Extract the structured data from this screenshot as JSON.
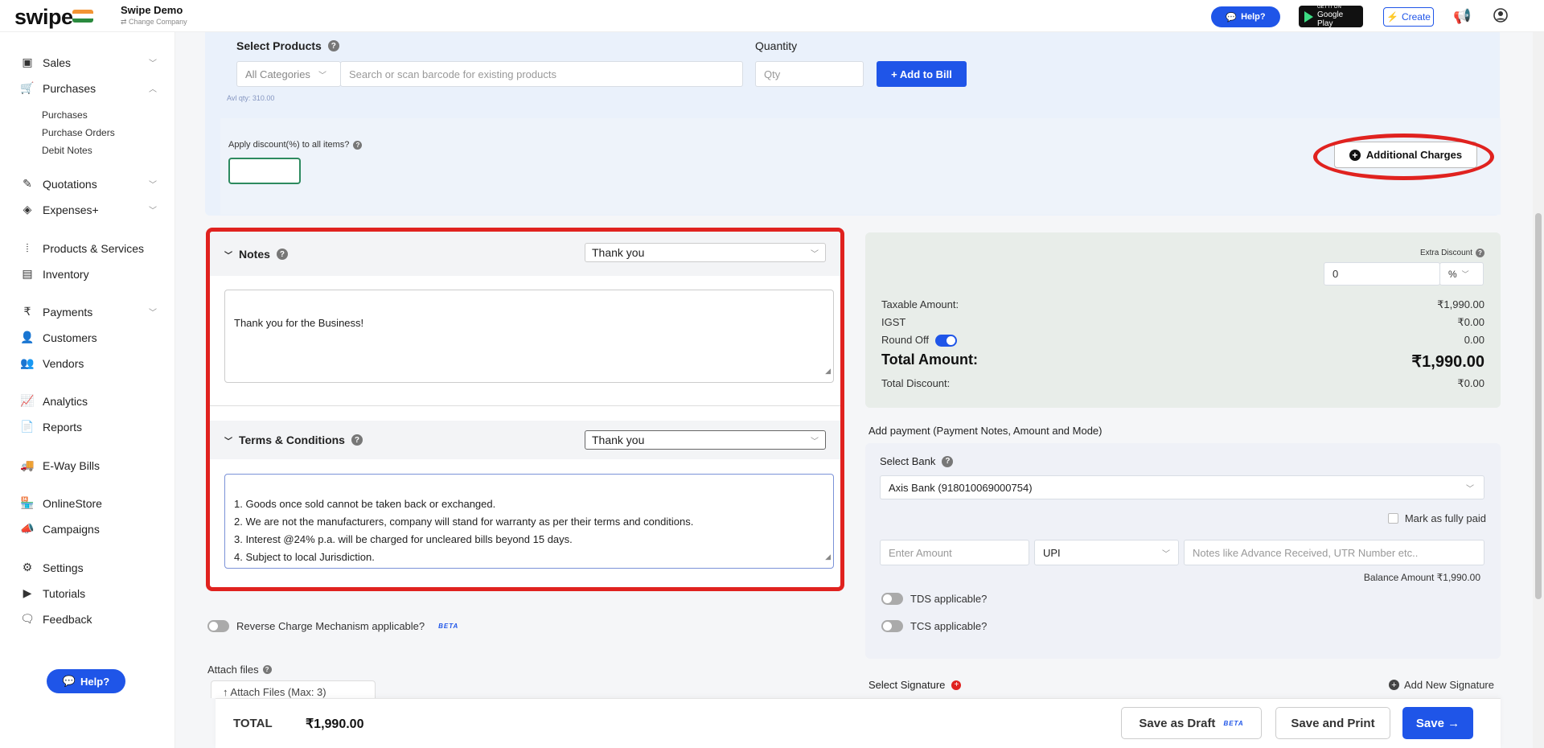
{
  "topbar": {
    "logo": "swipe",
    "company_name": "Swipe Demo",
    "change_company": "⇄ Change Company",
    "help_label": "Help?",
    "gplay_line1": "GET IT ON",
    "gplay_line2": "Google Play",
    "create_label": "Create"
  },
  "sidebar": {
    "sales": "Sales",
    "purchases": "Purchases",
    "sub_purchases": "Purchases",
    "sub_purchase_orders": "Purchase Orders",
    "sub_debit_notes": "Debit Notes",
    "quotations": "Quotations",
    "expenses": "Expenses+",
    "products_services": "Products & Services",
    "inventory": "Inventory",
    "payments": "Payments",
    "customers": "Customers",
    "vendors": "Vendors",
    "analytics": "Analytics",
    "reports": "Reports",
    "eway_bills": "E-Way Bills",
    "online_store": "OnlineStore",
    "campaigns": "Campaigns",
    "settings": "Settings",
    "tutorials": "Tutorials",
    "feedback": "Feedback",
    "help_label": "Help?"
  },
  "products": {
    "select_label": "Select Products",
    "quantity_label": "Quantity",
    "category_value": "All Categories",
    "search_placeholder": "Search or scan barcode for existing products",
    "qty_placeholder": "Qty",
    "add_to_bill": "+ Add to Bill",
    "avl_qty": "Avl qty: 310.00",
    "apply_discount_label": "Apply discount(%) to all items?",
    "additional_charges": "Additional Charges"
  },
  "notes": {
    "title": "Notes",
    "template": "Thank you",
    "text": "Thank you for the Business!"
  },
  "terms": {
    "title": "Terms & Conditions",
    "template": "Thank you",
    "text": "1. Goods once sold cannot be taken back or exchanged.\n2. We are not the manufacturers, company will stand for warranty as per their terms and conditions.\n3. Interest @24% p.a. will be charged for uncleared bills beyond 15 days.\n4. Subject to local Jurisdiction."
  },
  "options": {
    "reverse_charge": "Reverse Charge Mechanism applicable?",
    "beta": "BETA",
    "attach_files": "Attach files",
    "attach_button": "Attach Files (Max: 3)"
  },
  "totals": {
    "extra_discount_label": "Extra Discount",
    "extra_discount_value": "0",
    "extra_discount_unit": "%",
    "taxable_label": "Taxable Amount:",
    "taxable_value": "₹1,990.00",
    "igst_label": "IGST",
    "igst_value": "₹0.00",
    "round_off_label": "Round Off",
    "round_off_value": "0.00",
    "total_label": "Total Amount:",
    "total_value": "₹1,990.00",
    "total_discount_label": "Total Discount:",
    "total_discount_value": "₹0.00"
  },
  "payment": {
    "heading": "Add payment (Payment Notes, Amount and Mode)",
    "select_bank_label": "Select Bank",
    "bank_value": "Axis Bank (918010069000754)",
    "mark_paid": "Mark as fully paid",
    "amount_placeholder": "Enter Amount",
    "mode_value": "UPI",
    "notes_placeholder": "Notes like Advance Received, UTR Number etc..",
    "balance": "Balance Amount ₹1,990.00",
    "tds": "TDS applicable?",
    "tcs": "TCS applicable?"
  },
  "signature": {
    "label": "Select Signature",
    "add_new": "Add New Signature"
  },
  "footer": {
    "total_label": "TOTAL",
    "total_value": "₹1,990.00",
    "save_draft": "Save as Draft",
    "beta": "BETA",
    "save_print": "Save and Print",
    "save": "Save →"
  }
}
